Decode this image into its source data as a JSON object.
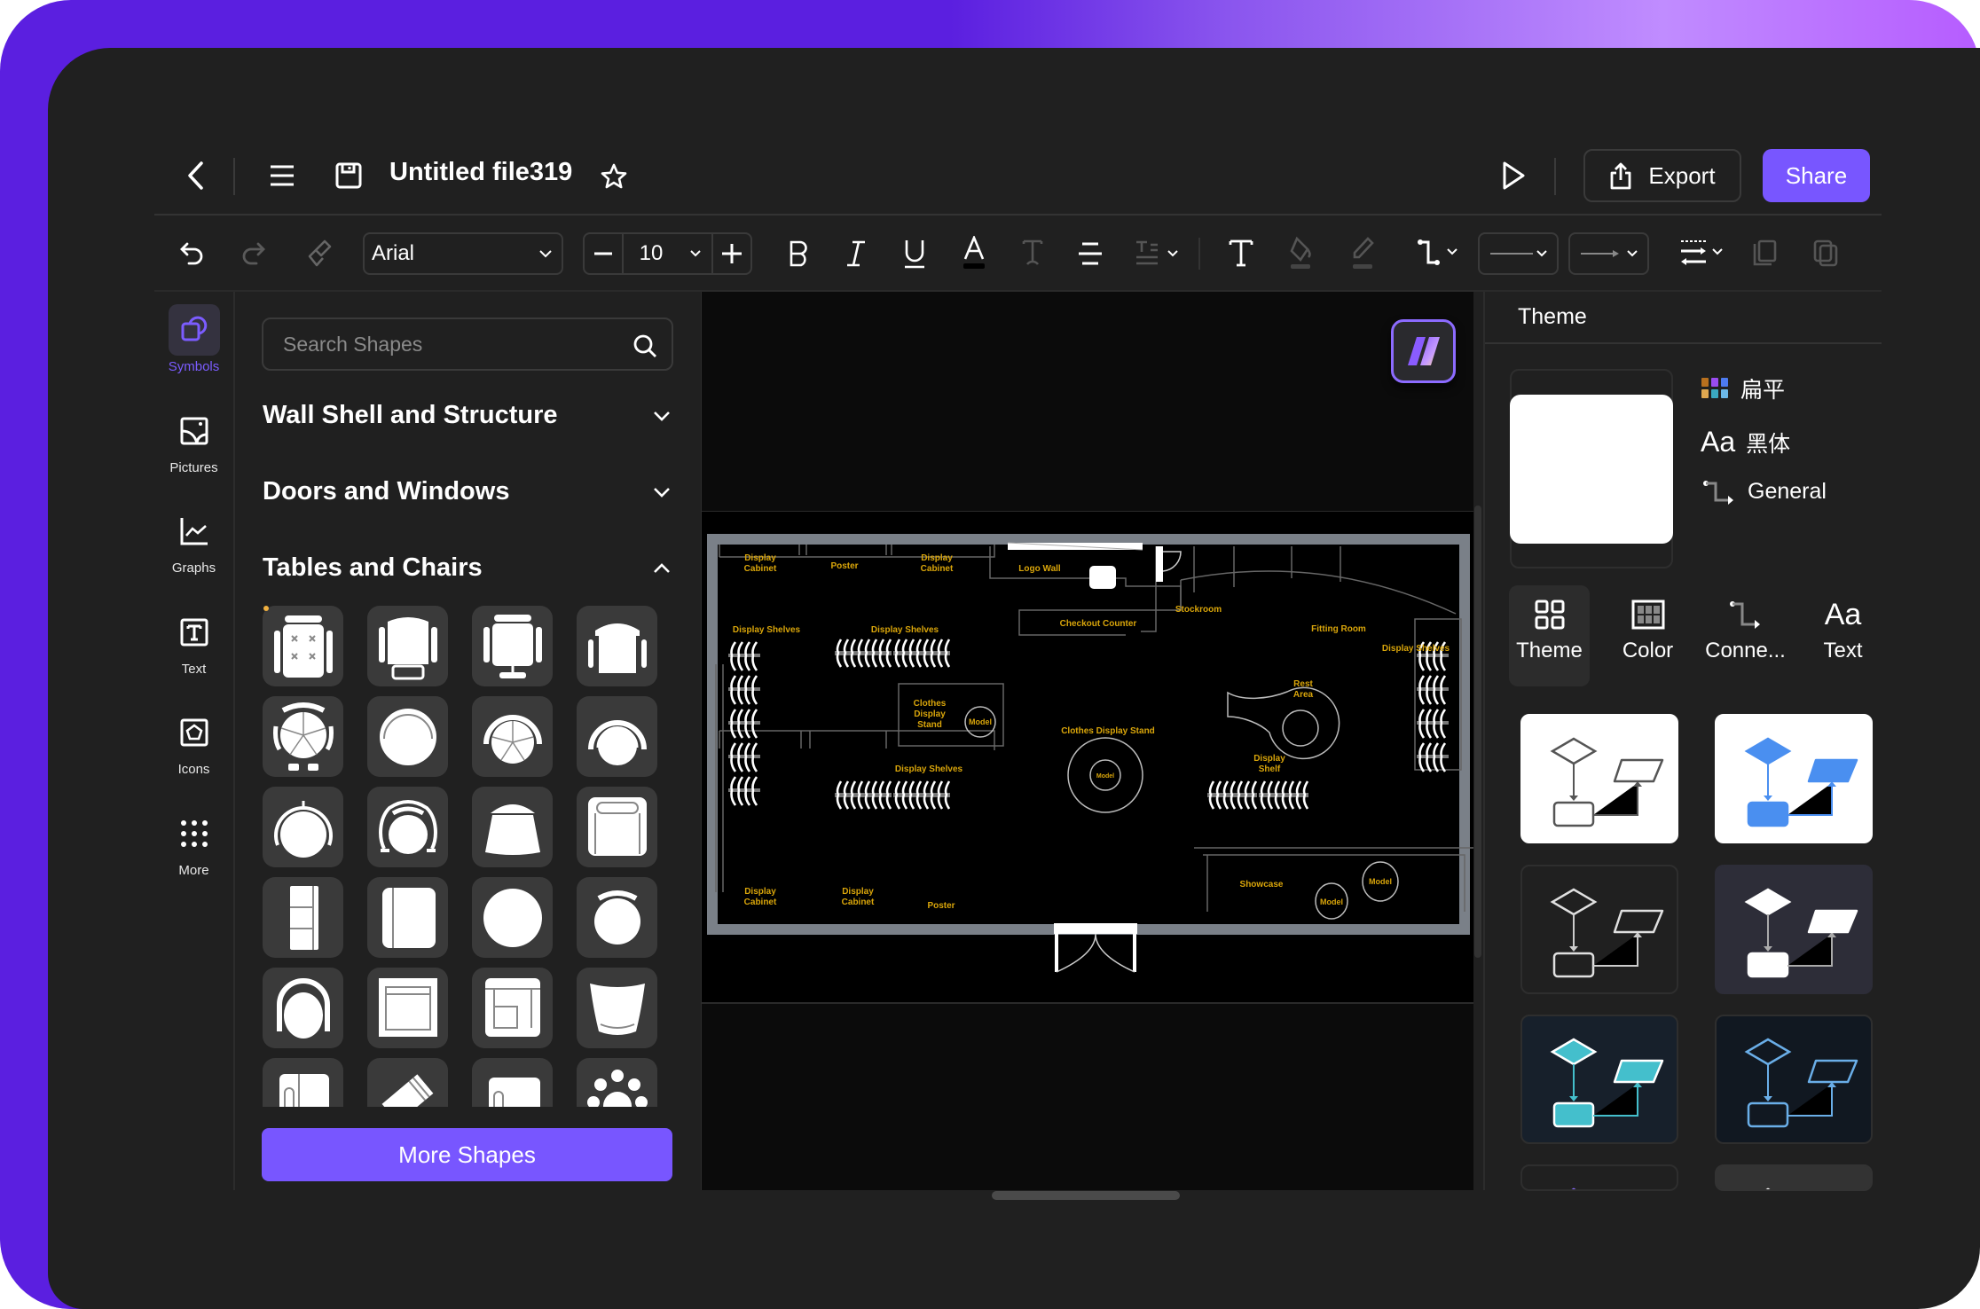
{
  "header": {
    "file_title": "Untitled file319",
    "export_label": "Export",
    "share_label": "Share"
  },
  "toolbar": {
    "font_family": "Arial",
    "font_size": "10"
  },
  "left_rail": {
    "items": [
      {
        "label": "Symbols",
        "icon": "symbols-icon",
        "active": true
      },
      {
        "label": "Pictures",
        "icon": "pictures-icon"
      },
      {
        "label": "Graphs",
        "icon": "graphs-icon"
      },
      {
        "label": "Text",
        "icon": "text-icon"
      },
      {
        "label": "Icons",
        "icon": "icons-icon"
      },
      {
        "label": "More",
        "icon": "more-icon"
      }
    ]
  },
  "shapes_panel": {
    "search_placeholder": "Search Shapes",
    "sections": [
      {
        "title": "Wall Shell and Structure",
        "expanded": false
      },
      {
        "title": "Doors and Windows",
        "expanded": false
      },
      {
        "title": "Tables and Chairs",
        "expanded": true
      }
    ],
    "more_shapes_label": "More Shapes"
  },
  "floor_plan": {
    "labels": {
      "display_cabinet": "Display\nCabinet",
      "poster": "Poster",
      "logo_wall": "Logo Wall",
      "checkout_counter": "Checkout Counter",
      "stockroom": "Stockroom",
      "fitting_room": "Fitting Room",
      "display_shelves": "Display Shelves",
      "clothes_display_stand_box": "Clothes Display Stand",
      "clothes_display_stand": "Clothes Display Stand",
      "model": "Model",
      "rest_area": "Rest Area",
      "display_shelf": "Display Shelf",
      "showcase": "Showcase"
    }
  },
  "right_panel": {
    "title": "Theme",
    "properties": [
      {
        "icon": "palette-grid-icon",
        "label": "扁平"
      },
      {
        "icon": "font-aa-icon",
        "label": "黑体"
      },
      {
        "icon": "connector-icon",
        "label": "General"
      }
    ],
    "tabs": [
      {
        "label": "Theme",
        "active": true
      },
      {
        "label": "Color"
      },
      {
        "label": "Conne..."
      },
      {
        "label": "Text"
      }
    ],
    "theme_colors": {
      "white_outline": "#555555",
      "blue": "#4a8ff0",
      "dark_outline": "#e0e0e0",
      "dark_filled": "#ffffff",
      "teal": "#44bfcc",
      "navy_outline": "#6aaee8"
    }
  },
  "colors": {
    "accent": "#7856ff",
    "plan_label": "#d9a50a",
    "wall": "#7a8088"
  }
}
